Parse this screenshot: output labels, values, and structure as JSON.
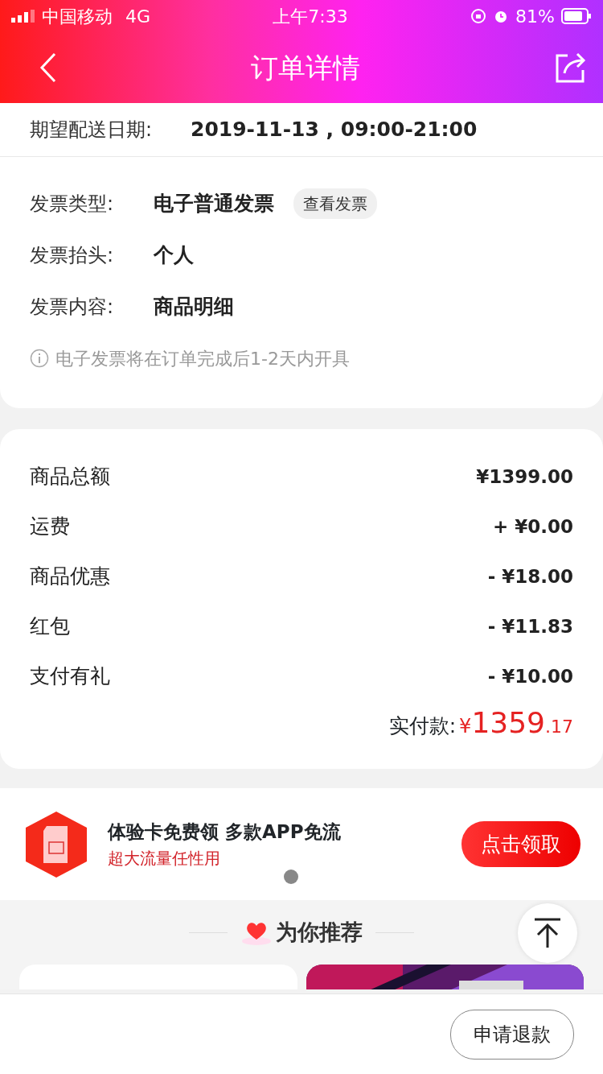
{
  "status_bar": {
    "carrier": "中国移动",
    "network": "4G",
    "time": "上午7:33",
    "battery": "81%"
  },
  "nav": {
    "title": "订单详情"
  },
  "delivery": {
    "label": "期望配送日期:",
    "value": "2019-11-13 , 09:00-21:00"
  },
  "invoice": [
    {
      "label": "发票类型:",
      "value": "电子普通发票",
      "action": "查看发票"
    },
    {
      "label": "发票抬头:",
      "value": "个人"
    },
    {
      "label": "发票内容:",
      "value": "商品明细"
    }
  ],
  "invoice_note": "电子发票将在订单完成后1-2天内开具",
  "prices": [
    {
      "label": "商品总额",
      "value": "¥1399.00"
    },
    {
      "label": "运费",
      "value": "+ ¥0.00"
    },
    {
      "label": "商品优惠",
      "value": "- ¥18.00"
    },
    {
      "label": "红包",
      "value": "- ¥11.83"
    },
    {
      "label": "支付有礼",
      "value": "- ¥10.00"
    }
  ],
  "total": {
    "label": "实付款:",
    "currency": "¥",
    "integer": "1359",
    "decimals": ".17"
  },
  "promo": {
    "title": "体验卡免费领 多款APP免流",
    "subtitle": "超大流量任性用",
    "button": "点击领取"
  },
  "recommend": {
    "title": "为你推荐"
  },
  "bottom": {
    "button": "申请退款"
  }
}
